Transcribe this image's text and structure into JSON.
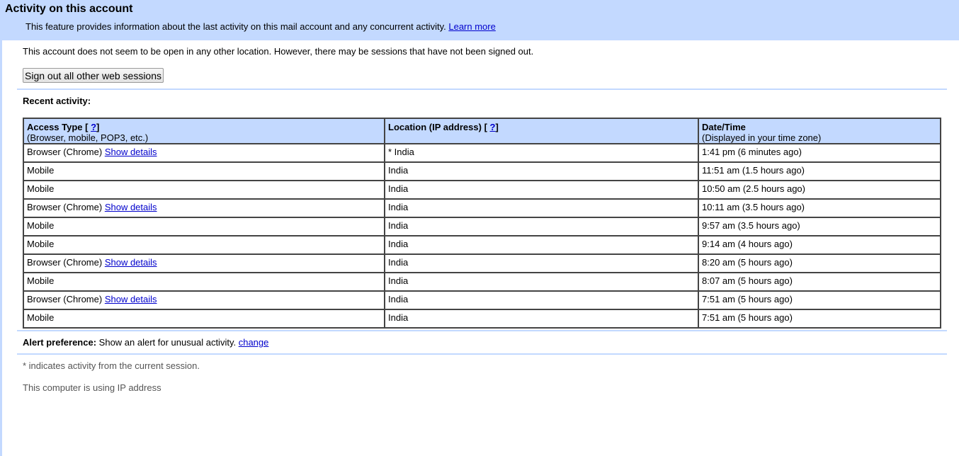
{
  "header": {
    "title": "Activity on this account",
    "subtitle": "This feature provides information about the last activity on this mail account and any concurrent activity.",
    "learn_more": "Learn more"
  },
  "status_text": "This account does not seem to be open in any other location. However, there may be sessions that have not been signed out.",
  "signout_button": "Sign out all other web sessions",
  "recent_activity_label": "Recent activity:",
  "table": {
    "headers": [
      {
        "title": "Access Type [",
        "help": "?",
        "close": "]",
        "sub": "(Browser, mobile, POP3, etc.)"
      },
      {
        "title": "Location (IP address) [",
        "help": "?",
        "close": "]",
        "sub": ""
      },
      {
        "title": "Date/Time",
        "help": "",
        "close": "",
        "sub": "(Displayed in your time zone)"
      }
    ],
    "rows": [
      {
        "access": "Browser (Chrome)",
        "details": "Show details",
        "location": "* India",
        "datetime": "1:41 pm (6 minutes ago)"
      },
      {
        "access": "Mobile",
        "details": "",
        "location": "India",
        "datetime": "11:51 am (1.5 hours ago)"
      },
      {
        "access": "Mobile",
        "details": "",
        "location": "India",
        "datetime": "10:50 am (2.5 hours ago)"
      },
      {
        "access": "Browser (Chrome)",
        "details": "Show details",
        "location": "India",
        "datetime": "10:11 am (3.5 hours ago)"
      },
      {
        "access": "Mobile",
        "details": "",
        "location": "India",
        "datetime": "9:57 am (3.5 hours ago)"
      },
      {
        "access": "Mobile",
        "details": "",
        "location": "India",
        "datetime": "9:14 am (4 hours ago)"
      },
      {
        "access": "Browser (Chrome)",
        "details": "Show details",
        "location": "India",
        "datetime": "8:20 am (5 hours ago)"
      },
      {
        "access": "Mobile",
        "details": "",
        "location": "India",
        "datetime": "8:07 am (5 hours ago)"
      },
      {
        "access": "Browser (Chrome)",
        "details": "Show details",
        "location": "India",
        "datetime": "7:51 am (5 hours ago)"
      },
      {
        "access": "Mobile",
        "details": "",
        "location": "India",
        "datetime": "7:51 am (5 hours ago)"
      }
    ]
  },
  "alert": {
    "label": "Alert preference:",
    "text": "Show an alert for unusual activity.",
    "change": "change"
  },
  "footnote": "* indicates activity from the current session.",
  "ip_text": "This computer is using IP address"
}
